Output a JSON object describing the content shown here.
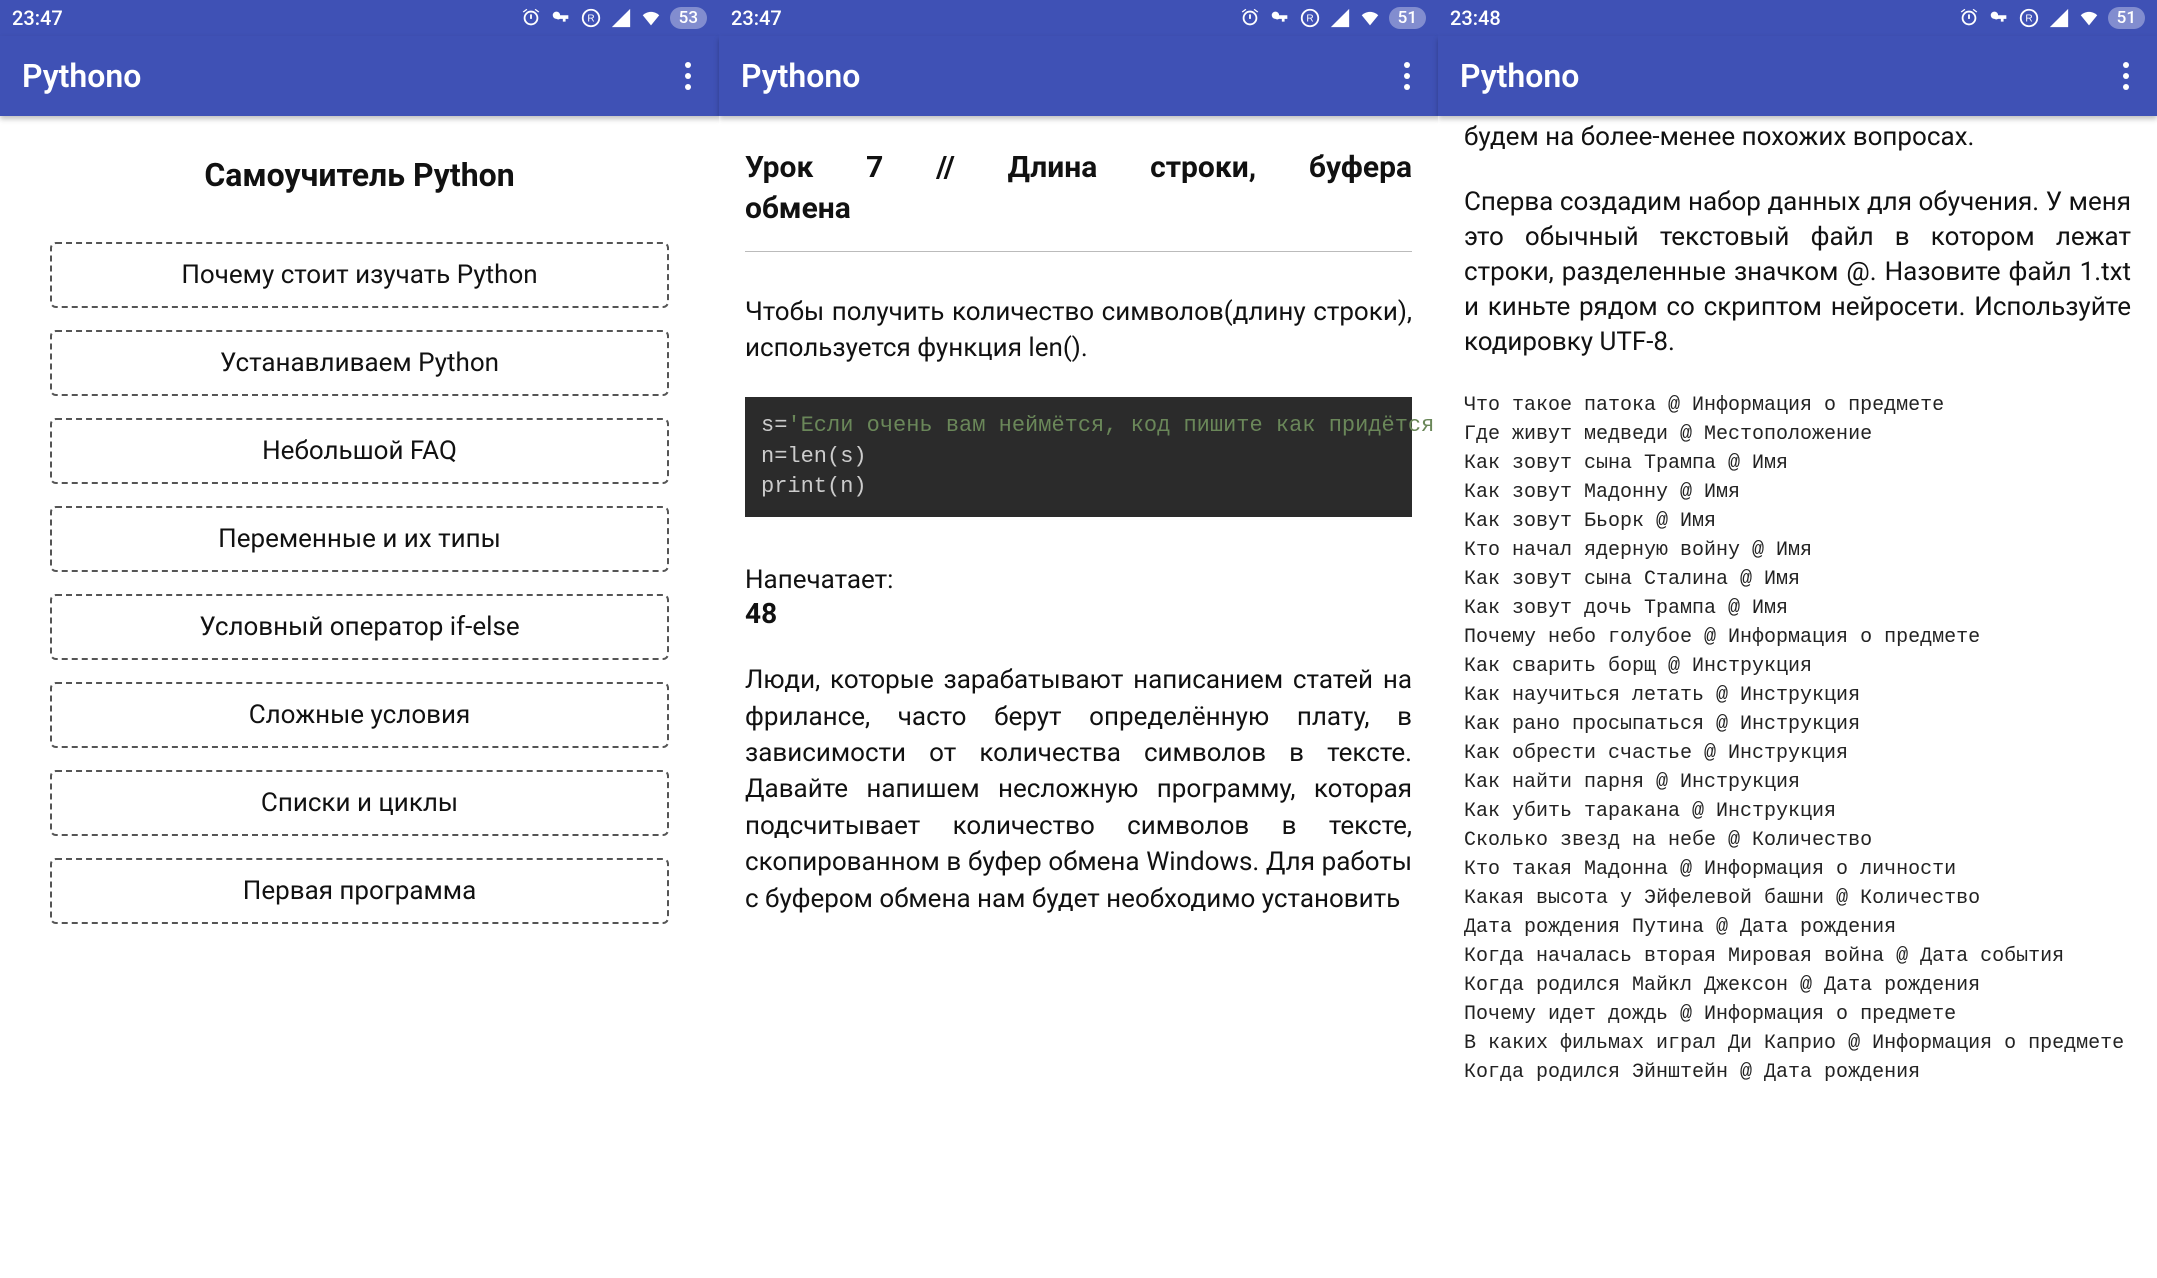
{
  "screen1": {
    "status": {
      "time": "23:47",
      "battery": "53"
    },
    "appbar": {
      "title": "Pythono"
    },
    "heading": "Самоучитель Python",
    "menu": [
      "Почему стоит изучать Python",
      "Устанавливаем Python",
      "Небольшой FAQ",
      "Переменные и их типы",
      "Условный оператор if-else",
      "Сложные условия",
      "Списки и циклы",
      "Первая программа"
    ]
  },
  "screen2": {
    "status": {
      "time": "23:47",
      "battery": "51"
    },
    "appbar": {
      "title": "Pythono"
    },
    "lesson_title_l1": "Урок 7 // Длина строки, буфера",
    "lesson_title_l2": "обмена",
    "p1": "Чтобы получить количество символов(длину строки), используется функция len().",
    "code_pre": "s=",
    "code_str": "'Если очень вам неймётся, код пишите как придётся'",
    "code_rest": "n=len(s)\nprint(n)",
    "result_label": "Напечатает:",
    "result_value": "48",
    "p2": "Люди, которые зарабатывают написанием статей на фрилансе, часто берут определённую плату, в зависимости от количества символов в тексте. Давайте напишем несложную программу, которая подсчитывает количество символов в тексте, скопированном в буфер обмена Windows. Для работы с буфером обмена нам будет необходимо установить"
  },
  "screen3": {
    "status": {
      "time": "23:48",
      "battery": "51"
    },
    "appbar": {
      "title": "Pythono"
    },
    "p0": "будем на более-менее похожих вопросах.",
    "p1": "Сперва создадим набор данных для обучения. У меня это обычный текстовый файл в котором лежат строки, разделенные значком @. Назовите файл 1.txt и киньте рядом со скриптом нейросети. Используйте кодировку UTF-8.",
    "dataset": [
      "Что такое патока @ Информация о предмете",
      "Где живут медведи @ Местоположение",
      "Как зовут сына Трампа @ Имя",
      "Как зовут Мадонну @ Имя",
      "Как зовут Бьорк @ Имя",
      "Кто начал ядерную войну @ Имя",
      "Как зовут сына Сталина @ Имя",
      "Как зовут дочь Трампа @ Имя",
      "Почему небо голубое @ Информация о предмете",
      "Как сварить борщ @ Инструкция",
      "Как научиться летать @ Инструкция",
      "Как рано просыпаться @ Инструкция",
      "Как обрести счастье @ Инструкция",
      "Как найти парня @ Инструкция",
      "Как убить таракана @ Инструкция",
      "Сколько звезд на небе @ Количество",
      "Кто такая Мадонна @ Информация о личности",
      "Какая высота у Эйфелевой башни @ Количество",
      "Дата рождения Путина @ Дата рождения",
      "Когда началась вторая Мировая война @ Дата события",
      "Когда родился Майкл Джексон @ Дата рождения",
      "Почему идет дождь @ Информация о предмете",
      "В каких фильмах играл Ди Каприо @ Информация о предмете",
      "Когда родился Эйнштейн @ Дата рождения"
    ]
  }
}
